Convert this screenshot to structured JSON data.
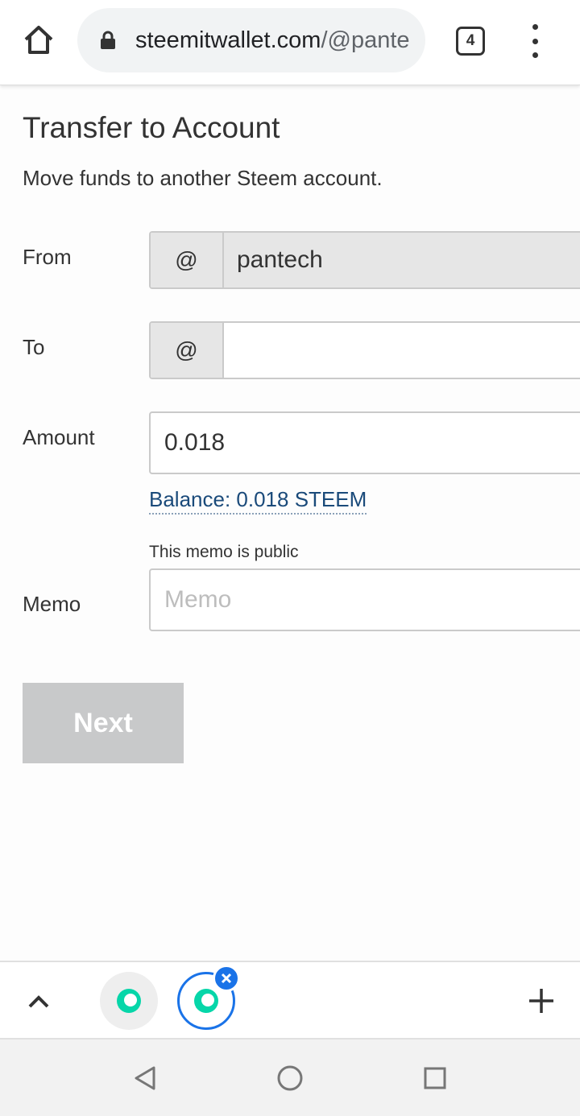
{
  "browser": {
    "url_domain": "steemitwallet.com",
    "url_path": "/@pantech",
    "tab_count": "4",
    "icons": [
      "home-icon",
      "lock-icon",
      "tab-switcher-icon",
      "more-vert-icon"
    ]
  },
  "page": {
    "title": "Transfer to Account",
    "description": "Move funds to another Steem account."
  },
  "form": {
    "from": {
      "label": "From",
      "prefix": "@",
      "value": "pantech"
    },
    "to": {
      "label": "To",
      "prefix": "@",
      "value": ""
    },
    "amount": {
      "label": "Amount",
      "value": "0.018"
    },
    "balance": "Balance: 0.018 STEEM",
    "memo_note": "This memo is public",
    "memo": {
      "label": "Memo",
      "placeholder": "Memo",
      "value": ""
    },
    "next_label": "Next"
  },
  "tab_strip": {
    "icons": [
      "chevron-up-icon",
      "steemit-favicon",
      "close-icon",
      "plus-icon"
    ]
  },
  "nav_bar": {
    "icons": [
      "back-triangle-icon",
      "home-circle-icon",
      "recents-square-icon"
    ]
  },
  "colors": {
    "link": "#1a4a7a",
    "addon_bg": "#e6e6e6",
    "button_disabled": "#c8c9ca",
    "active_tab": "#1a73e8",
    "favicon": "#06d6a9"
  }
}
